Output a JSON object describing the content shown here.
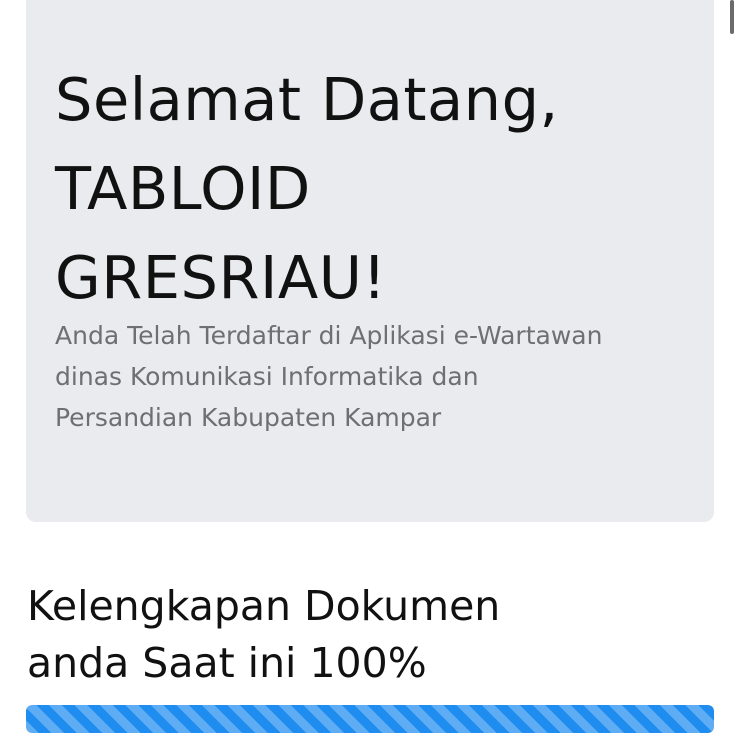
{
  "welcome": {
    "title_lines": [
      "Selamat Datang,",
      "TABLOID",
      "GRESRIAU!"
    ],
    "description_lines": [
      "Anda Telah Terdaftar di Aplikasi e-Wartawan",
      "dinas Komunikasi Informatika dan",
      "Persandian Kabupaten Kampar"
    ]
  },
  "documents": {
    "heading_lines": [
      "Kelengkapan Dokumen",
      "anda Saat ini 100%"
    ],
    "progress_percent": 100
  },
  "colors": {
    "card_background": "#e9ebee",
    "progress_fill": "#1f8cf0"
  }
}
